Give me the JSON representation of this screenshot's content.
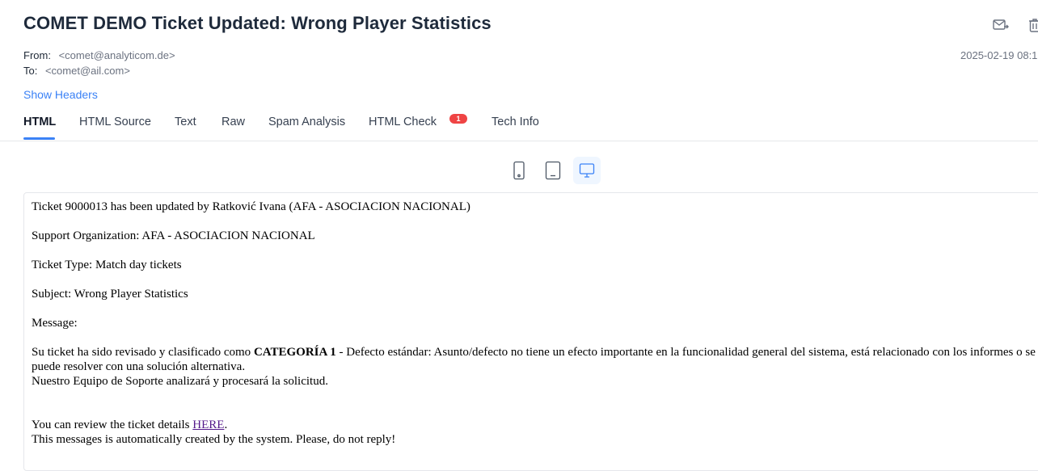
{
  "email": {
    "subject": "COMET DEMO Ticket Updated: Wrong Player Statistics",
    "from_label": "From:",
    "from_value": "<comet@analyticom.de>",
    "to_label": "To:",
    "to_value": "<comet@ail.com>",
    "date": "2025-02-19 08:1",
    "show_headers": "Show Headers"
  },
  "actions": {
    "forward_icon": "mail-forward-icon",
    "delete_icon": "trash-icon"
  },
  "tabs": [
    {
      "label": "HTML",
      "active": true
    },
    {
      "label": "HTML Source"
    },
    {
      "label": "Text"
    },
    {
      "label": "Raw"
    },
    {
      "label": "Spam Analysis"
    },
    {
      "label": "HTML Check",
      "badge": "1"
    },
    {
      "label": "Tech Info"
    }
  ],
  "device_toggle": {
    "options": [
      "mobile",
      "tablet",
      "desktop"
    ],
    "selected": "desktop"
  },
  "colors": {
    "accent": "#3b82f6",
    "badge": "#ef4444",
    "link": "#551a8b"
  },
  "body": {
    "line1": "Ticket 9000013 has been updated by Ratković Ivana (AFA - ASOCIACION NACIONAL)",
    "line2": "Support Organization: AFA - ASOCIACION NACIONAL",
    "line3": "Ticket Type: Match day tickets",
    "line4": "Subject: Wrong Player Statistics",
    "line5": "Message:",
    "msg_pre": "Su ticket ha sido revisado y clasificado como ",
    "msg_bold": "CATEGORÍA 1",
    "msg_post": " - Defecto estándar: Asunto/defecto no tiene un efecto importante en la funcionalidad general del sistema, está relacionado con los informes o se puede resolver con una solución alternativa.",
    "msg_line2": "Nuestro Equipo de Soporte analizará y procesará la solicitud.",
    "review_pre": "You can review the ticket details ",
    "review_link": "HERE",
    "review_post": ".",
    "footer": "This messages is automatically created by the system. Please, do not reply!"
  }
}
